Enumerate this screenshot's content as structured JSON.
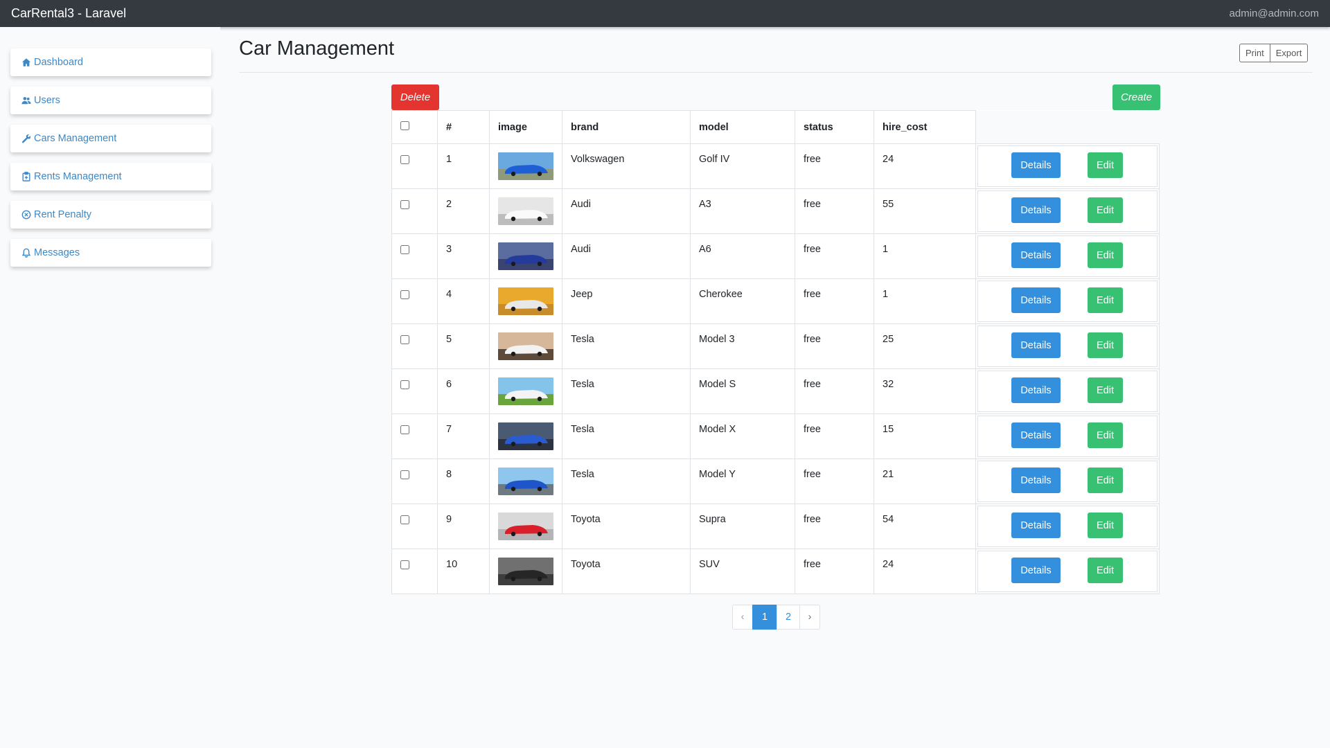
{
  "app": {
    "title": "CarRental3 - Laravel",
    "user_email": "admin@admin.com"
  },
  "sidebar": {
    "items": [
      {
        "label": "Dashboard",
        "icon": "home-icon"
      },
      {
        "label": "Users",
        "icon": "users-icon"
      },
      {
        "label": "Cars Management",
        "icon": "wrench-icon"
      },
      {
        "label": "Rents Management",
        "icon": "clipboard-icon"
      },
      {
        "label": "Rent Penalty",
        "icon": "x-circle-icon"
      },
      {
        "label": "Messages",
        "icon": "bell-icon"
      }
    ]
  },
  "page": {
    "title": "Car Management",
    "print_label": "Print",
    "export_label": "Export",
    "delete_label": "Delete",
    "create_label": "Create"
  },
  "table": {
    "headers": [
      "#",
      "image",
      "brand",
      "model",
      "status",
      "hire_cost"
    ],
    "details_label": "Details",
    "edit_label": "Edit",
    "rows": [
      {
        "id": "1",
        "brand": "Volkswagen",
        "model": "Golf IV",
        "status": "free",
        "hire_cost": "24",
        "img_sky": "#6aa9e0",
        "img_ground": "#8f9a7a",
        "img_car": "#1f5fd6"
      },
      {
        "id": "2",
        "brand": "Audi",
        "model": "A3",
        "status": "free",
        "hire_cost": "55",
        "img_sky": "#e6e6e6",
        "img_ground": "#bdbdbd",
        "img_car": "#fafafa"
      },
      {
        "id": "3",
        "brand": "Audi",
        "model": "A6",
        "status": "free",
        "hire_cost": "1",
        "img_sky": "#5b6c9e",
        "img_ground": "#3a4470",
        "img_car": "#243a9c"
      },
      {
        "id": "4",
        "brand": "Jeep",
        "model": "Cherokee",
        "status": "free",
        "hire_cost": "1",
        "img_sky": "#e8a92c",
        "img_ground": "#c98c2a",
        "img_car": "#e8e8e8"
      },
      {
        "id": "5",
        "brand": "Tesla",
        "model": "Model 3",
        "status": "free",
        "hire_cost": "25",
        "img_sky": "#d7b79a",
        "img_ground": "#5e4a3a",
        "img_car": "#f2f2f2"
      },
      {
        "id": "6",
        "brand": "Tesla",
        "model": "Model S",
        "status": "free",
        "hire_cost": "32",
        "img_sky": "#84c3ea",
        "img_ground": "#6aa43c",
        "img_car": "#f4f4f4"
      },
      {
        "id": "7",
        "brand": "Tesla",
        "model": "Model X",
        "status": "free",
        "hire_cost": "15",
        "img_sky": "#4a5a73",
        "img_ground": "#2b3340",
        "img_car": "#2a5bd1"
      },
      {
        "id": "8",
        "brand": "Tesla",
        "model": "Model Y",
        "status": "free",
        "hire_cost": "21",
        "img_sky": "#8ec6ee",
        "img_ground": "#6f7a80",
        "img_car": "#1e55c8"
      },
      {
        "id": "9",
        "brand": "Toyota",
        "model": "Supra",
        "status": "free",
        "hire_cost": "54",
        "img_sky": "#d9d9d9",
        "img_ground": "#b5b5b5",
        "img_car": "#d81f2a"
      },
      {
        "id": "10",
        "brand": "Toyota",
        "model": "SUV",
        "status": "free",
        "hire_cost": "24",
        "img_sky": "#707070",
        "img_ground": "#3d3d3d",
        "img_car": "#262626"
      }
    ]
  },
  "pagination": {
    "prev": "‹",
    "pages": [
      "1",
      "2"
    ],
    "next": "›",
    "current": "1"
  }
}
